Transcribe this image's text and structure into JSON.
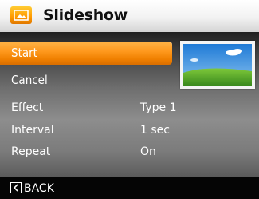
{
  "header": {
    "title": "Slideshow",
    "icon": "slideshow-icon"
  },
  "menu": {
    "items": [
      {
        "label": "Start",
        "selected": true
      },
      {
        "label": "Cancel",
        "selected": false
      }
    ]
  },
  "settings": {
    "rows": [
      {
        "name": "Effect",
        "value": "Type 1"
      },
      {
        "name": "Interval",
        "value": "1 sec"
      },
      {
        "name": "Repeat",
        "value": "On"
      }
    ]
  },
  "preview": {
    "icon": "landscape-thumbnail-icon"
  },
  "footer": {
    "back_label": "BACK",
    "back_icon": "chevron-left-icon"
  },
  "colors": {
    "accent": "#ff9a1f",
    "header_bg": "#f2f2f2",
    "text": "#ffffff",
    "footer_bg": "#050505"
  }
}
